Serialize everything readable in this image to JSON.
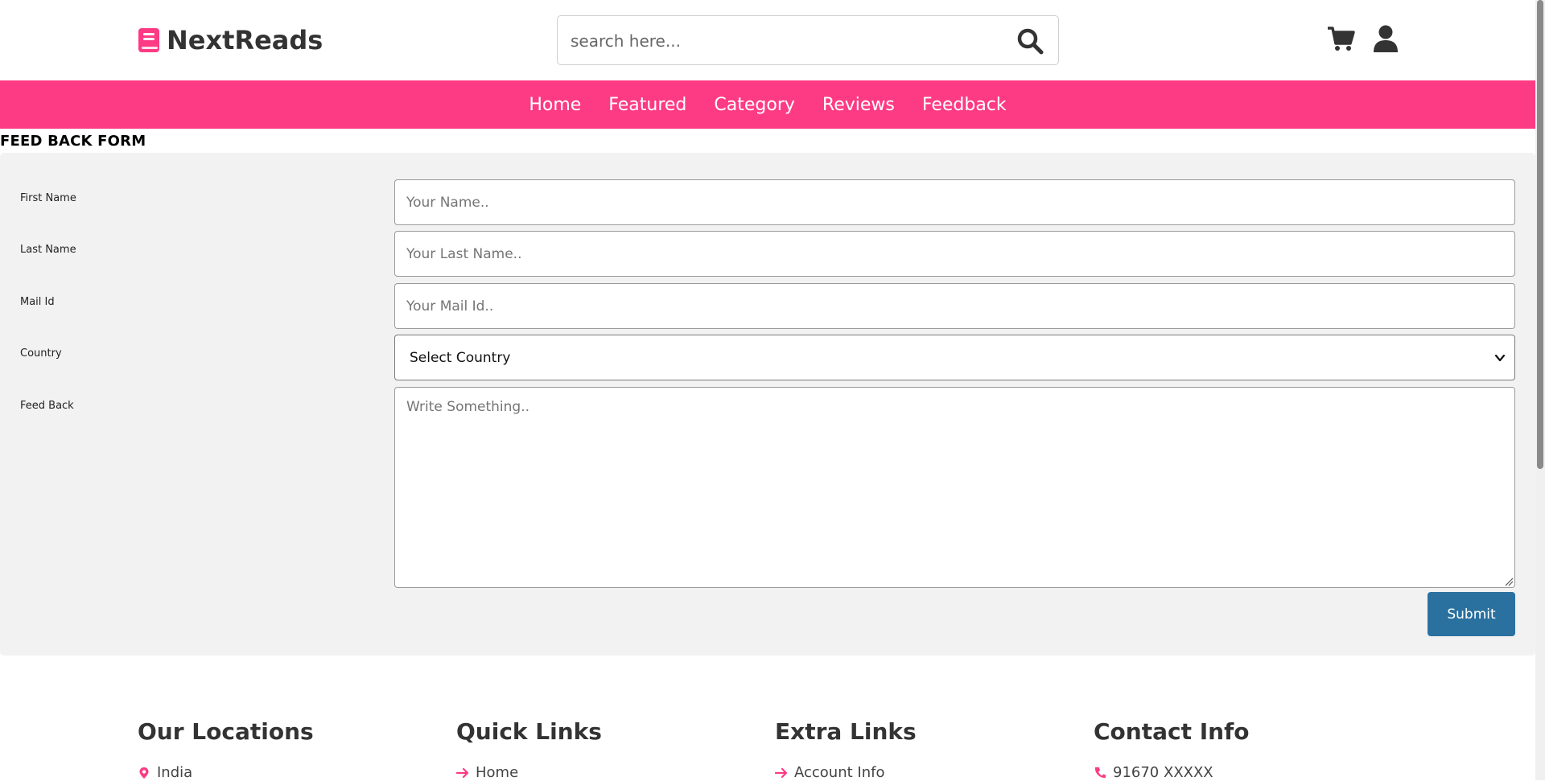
{
  "brand": {
    "name": "NextReads",
    "icon": "book-icon",
    "accent": "#fd3b84"
  },
  "search": {
    "placeholder": "search here...",
    "value": ""
  },
  "nav": {
    "items": [
      {
        "label": "Home"
      },
      {
        "label": "Featured"
      },
      {
        "label": "Category"
      },
      {
        "label": "Reviews"
      },
      {
        "label": "Feedback"
      }
    ]
  },
  "header_icons": [
    "cart-icon",
    "user-icon"
  ],
  "form": {
    "title": "FEED BACK FORM",
    "first_name": {
      "label": "First Name",
      "placeholder": "Your Name.."
    },
    "last_name": {
      "label": "Last Name",
      "placeholder": "Your Last Name.."
    },
    "mail": {
      "label": "Mail Id",
      "placeholder": "Your Mail Id.."
    },
    "country": {
      "label": "Country",
      "selected": "Select Country"
    },
    "feedback": {
      "label": "Feed Back",
      "placeholder": "Write Something.."
    },
    "submit_label": "Submit",
    "submit_color": "#2a71a0"
  },
  "footer": {
    "columns": [
      {
        "title": "Our Locations",
        "first_item": "India",
        "icon": "map-pin-icon"
      },
      {
        "title": "Quick Links",
        "first_item": "Home",
        "icon": "arrow-right-icon"
      },
      {
        "title": "Extra Links",
        "first_item": "Account Info",
        "icon": "arrow-right-icon"
      },
      {
        "title": "Contact Info",
        "first_item": "91670 XXXXX",
        "icon": "phone-icon"
      }
    ]
  }
}
